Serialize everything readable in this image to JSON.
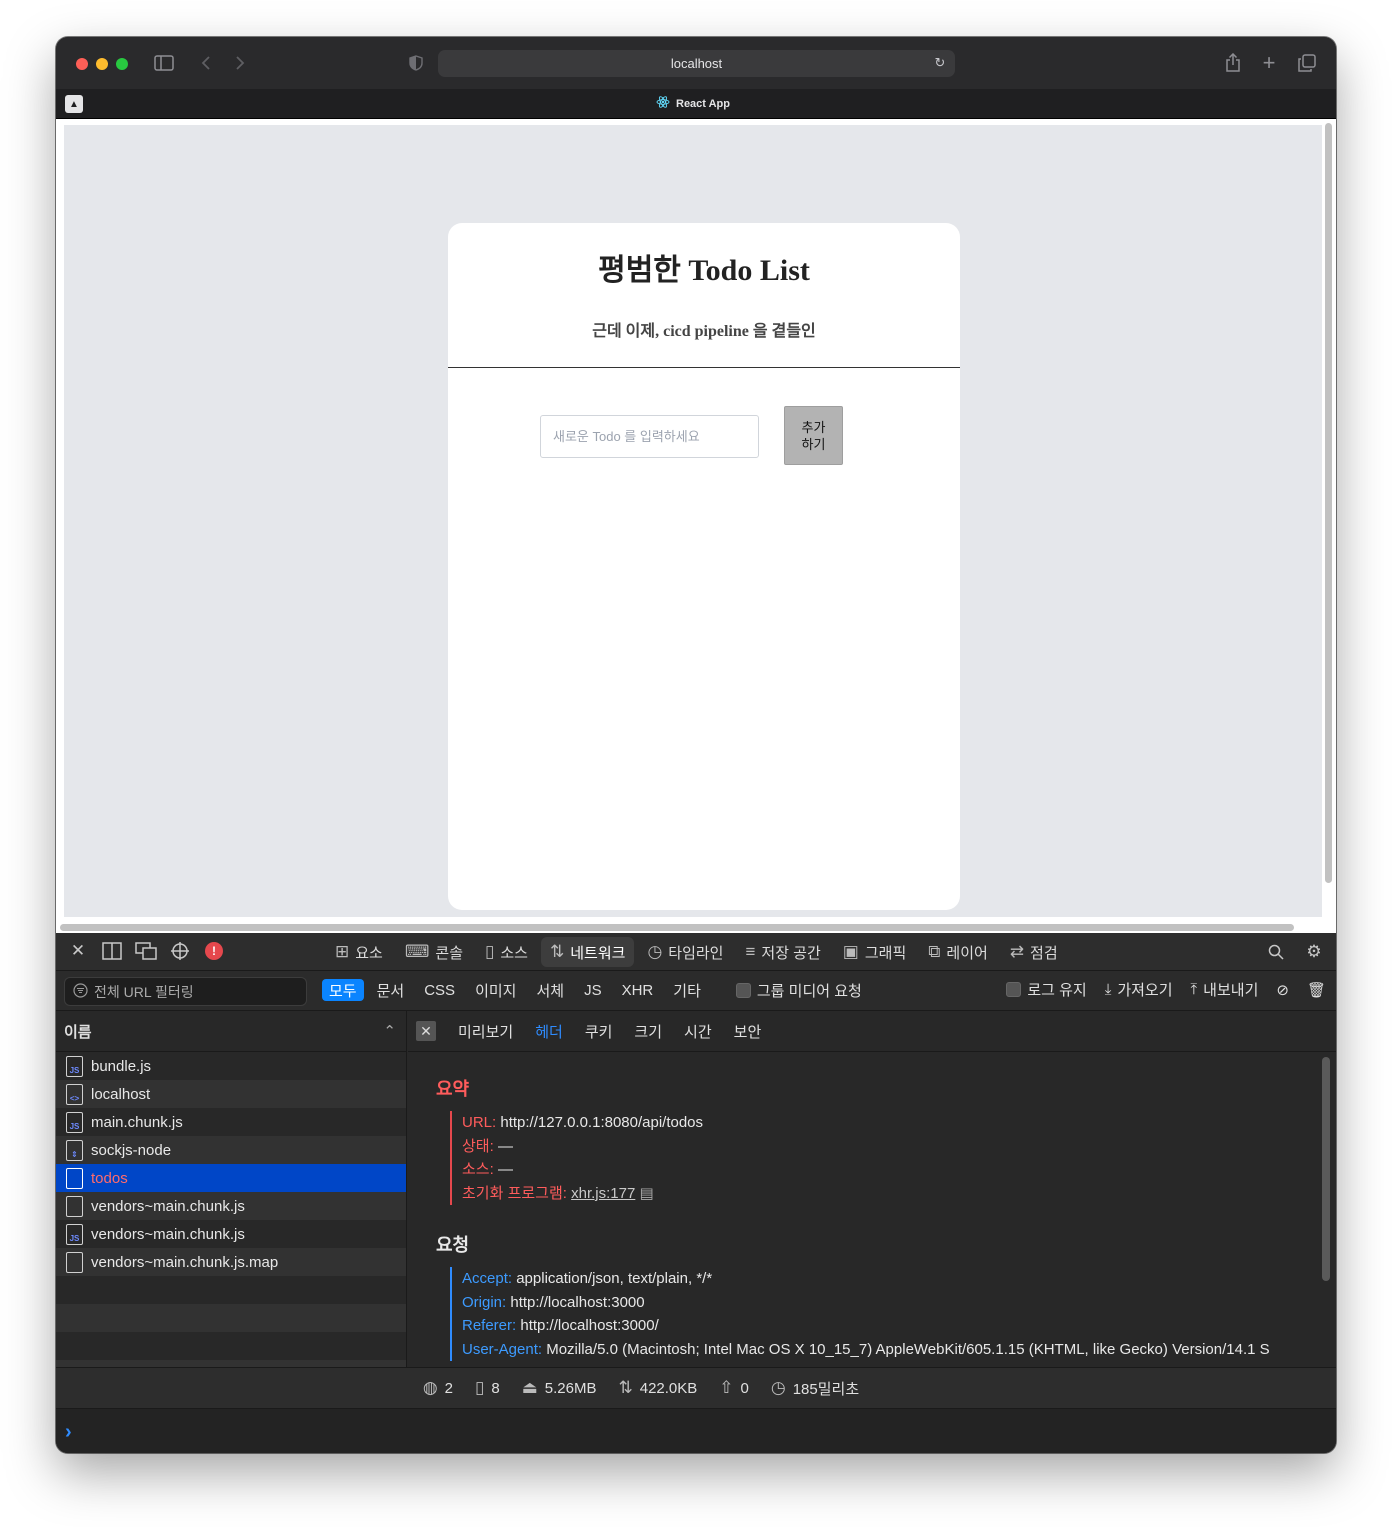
{
  "browser": {
    "url": "localhost",
    "tab_title": "React App"
  },
  "app": {
    "title": "평범한 Todo List",
    "subtitle": "근데 이제, cicd pipeline 을 곁들인",
    "input_placeholder": "새로운 Todo 를 입력하세요",
    "add_button": "추가\n하기"
  },
  "devtools": {
    "tabs": [
      {
        "label": "요소",
        "icon": "elements-icon"
      },
      {
        "label": "콘솔",
        "icon": "console-icon"
      },
      {
        "label": "소스",
        "icon": "sources-icon"
      },
      {
        "label": "네트워크",
        "icon": "network-icon",
        "active": true
      },
      {
        "label": "타임라인",
        "icon": "timeline-icon"
      },
      {
        "label": "저장 공간",
        "icon": "storage-icon"
      },
      {
        "label": "그래픽",
        "icon": "graphics-icon"
      },
      {
        "label": "레이어",
        "icon": "layers-icon"
      },
      {
        "label": "점검",
        "icon": "audit-icon"
      }
    ],
    "url_filter_placeholder": "전체 URL 필터링",
    "filter_types": [
      "모두",
      "문서",
      "CSS",
      "이미지",
      "서체",
      "JS",
      "XHR",
      "기타"
    ],
    "group_media": "그룹 미디어 요청",
    "preserve_log": "로그 유지",
    "import": "가져오기",
    "export": "내보내기",
    "list_header": "이름",
    "files": [
      {
        "name": "bundle.js",
        "type": "JS"
      },
      {
        "name": "localhost",
        "type": "<>"
      },
      {
        "name": "main.chunk.js",
        "type": "JS"
      },
      {
        "name": "sockjs-node",
        "type": "⇕"
      },
      {
        "name": "todos",
        "type": "",
        "selected": true
      },
      {
        "name": "vendors~main.chunk.js",
        "type": ""
      },
      {
        "name": "vendors~main.chunk.js",
        "type": "JS"
      },
      {
        "name": "vendors~main.chunk.js.map",
        "type": ""
      }
    ],
    "detail_tabs": [
      "미리보기",
      "헤더",
      "쿠키",
      "크기",
      "시간",
      "보안"
    ],
    "active_detail_tab": "헤더",
    "summary_title": "요약",
    "summary": {
      "url_key": "URL:",
      "url_val": "http://127.0.0.1:8080/api/todos",
      "status_key": "상태:",
      "status_val": "—",
      "source_key": "소스:",
      "source_val": "—",
      "initiator_key": "초기화 프로그램:",
      "initiator_val": "xhr.js:177"
    },
    "request_title": "요청",
    "request": {
      "accept_key": "Accept:",
      "accept_val": "application/json, text/plain, */*",
      "origin_key": "Origin:",
      "origin_val": "http://localhost:3000",
      "referer_key": "Referer:",
      "referer_val": "http://localhost:3000/",
      "ua_key": "User-Agent:",
      "ua_val": "Mozilla/5.0 (Macintosh; Intel Mac OS X 10_15_7) AppleWebKit/605.1.15 (KHTML, like Gecko) Version/14.1 S"
    },
    "status": {
      "requests": "2",
      "resources": "8",
      "transferred": "5.26MB",
      "size": "422.0KB",
      "redirects": "0",
      "time": "185밀리초"
    }
  },
  "colors": {
    "accent": "#0a84ff",
    "selection": "#0046c7",
    "error": "#e5484d",
    "page_bg": "#e5e7eb"
  }
}
